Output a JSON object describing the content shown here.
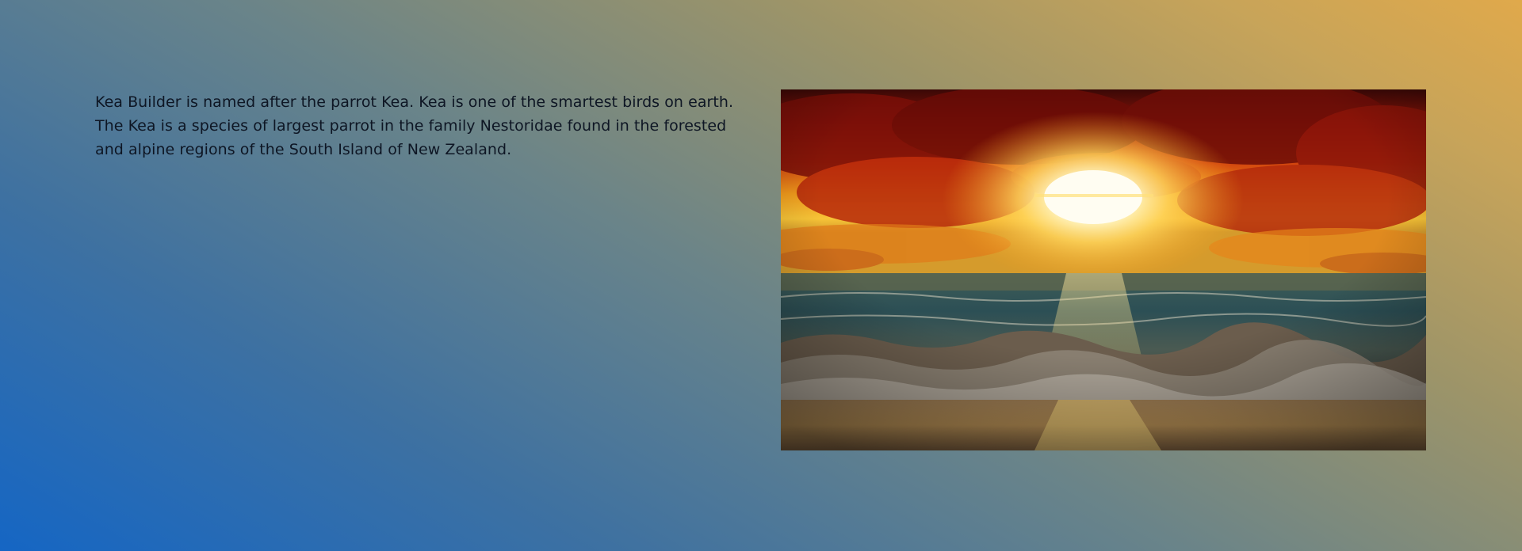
{
  "about": {
    "description": "Kea Builder is named after the parrot Kea. Kea is one of the smartest birds on earth. The Kea is a species of largest parrot in the family Nestoridae found in the forested and alpine regions of the South Island of New Zealand."
  },
  "image": {
    "subject": "sunset-over-ocean-waves"
  },
  "colors": {
    "text": "#0e1624",
    "gradient_start": "#1566c4",
    "gradient_end": "#e0a94b"
  }
}
